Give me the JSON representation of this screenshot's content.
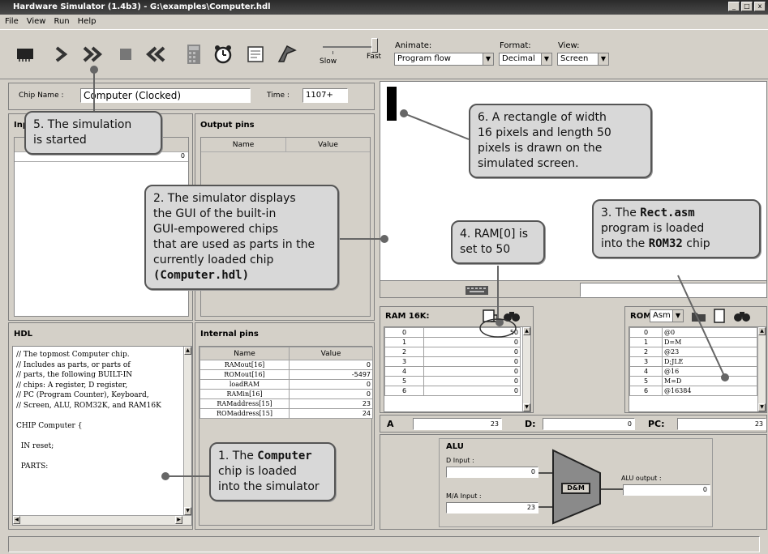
{
  "window": {
    "title": "Hardware Simulator (1.4b3) - G:\\examples\\Computer.hdl",
    "controls": [
      "_",
      "□",
      "x"
    ]
  },
  "menu": [
    "File",
    "View",
    "Run",
    "Help"
  ],
  "toolbar": {
    "speed_slow": "Slow",
    "speed_fast": "Fast",
    "animate_label": "Animate:",
    "animate_value": "Program flow",
    "format_label": "Format:",
    "format_value": "Decimal",
    "view_label": "View:",
    "view_value": "Screen"
  },
  "chip": {
    "name_label": "Chip Name :",
    "name_value": "Computer (Clocked)",
    "time_label": "Time :",
    "time_value": "1107+"
  },
  "input_pins": {
    "title": "Input pins",
    "row_value": "0"
  },
  "output_pins": {
    "title": "Output pins",
    "col_name": "Name",
    "col_value": "Value"
  },
  "hdl": {
    "title": "HDL",
    "lines": [
      "// The topmost Computer chip.",
      "// Includes as parts, or parts of",
      "// parts, the following BUILT-IN",
      "// chips: A register, D register,",
      "// PC (Program Counter), Keyboard,",
      "// Screen, ALU, ROM32K, and RAM16K",
      "",
      "CHIP Computer {",
      "",
      "  IN reset;",
      "",
      "  PARTS:"
    ]
  },
  "internal_pins": {
    "title": "Internal pins",
    "col_name": "Name",
    "col_value": "Value",
    "rows": [
      {
        "name": "RAMout[16]",
        "value": "0"
      },
      {
        "name": "ROMout[16]",
        "value": "-5497"
      },
      {
        "name": "loadRAM",
        "value": "0"
      },
      {
        "name": "RAMin[16]",
        "value": "0"
      },
      {
        "name": "RAMaddress[15]",
        "value": "23"
      },
      {
        "name": "ROMaddress[15]",
        "value": "24"
      }
    ]
  },
  "ram": {
    "title": "RAM 16K:",
    "rows": [
      {
        "addr": "0",
        "value": "50"
      },
      {
        "addr": "1",
        "value": "0"
      },
      {
        "addr": "2",
        "value": "0"
      },
      {
        "addr": "3",
        "value": "0"
      },
      {
        "addr": "4",
        "value": "0"
      },
      {
        "addr": "5",
        "value": "0"
      },
      {
        "addr": "6",
        "value": "0"
      }
    ]
  },
  "rom": {
    "title": "ROM:",
    "format": "Asm",
    "rows": [
      {
        "addr": "0",
        "instr": "@0"
      },
      {
        "addr": "1",
        "instr": "D=M"
      },
      {
        "addr": "2",
        "instr": "@23"
      },
      {
        "addr": "3",
        "instr": "D;JLE"
      },
      {
        "addr": "4",
        "instr": "@16"
      },
      {
        "addr": "5",
        "instr": "M=D"
      },
      {
        "addr": "6",
        "instr": "@16384"
      }
    ]
  },
  "registers": {
    "a_label": "A",
    "a_value": "23",
    "d_label": "D:",
    "d_value": "0",
    "pc_label": "PC:",
    "pc_value": "23"
  },
  "alu": {
    "title": "ALU",
    "d_input_label": "D Input :",
    "d_input_value": "0",
    "ma_input_label": "M/A Input :",
    "ma_input_value": "23",
    "op": "D&M",
    "output_label": "ALU output :",
    "output_value": "0"
  },
  "callouts": {
    "c1_a": "1. The ",
    "c1_code": "Computer",
    "c1_b": "chip is loaded",
    "c1_c": "into the simulator",
    "c2_a": "2. The simulator displays",
    "c2_b": "the GUI of the built-in",
    "c2_c": "GUI-empowered chips",
    "c2_d": "that are used as parts in the",
    "c2_e": "currently  loaded chip",
    "c2_f_code": "(Computer.hdl)",
    "c3_a": "3. The ",
    "c3_code": "Rect.asm",
    "c3_b": "program is loaded",
    "c3_c": "into the ",
    "c3_code2": "ROM32",
    "c3_d": " chip",
    "c4_a": "4. RAM[0] is",
    "c4_b": "set to 50",
    "c5_a": "5. The simulation",
    "c5_b": "is started",
    "c6_a": "6. A rectangle of width",
    "c6_b": "16 pixels and length 50",
    "c6_c": "pixels is drawn on the",
    "c6_d": "simulated screen."
  }
}
